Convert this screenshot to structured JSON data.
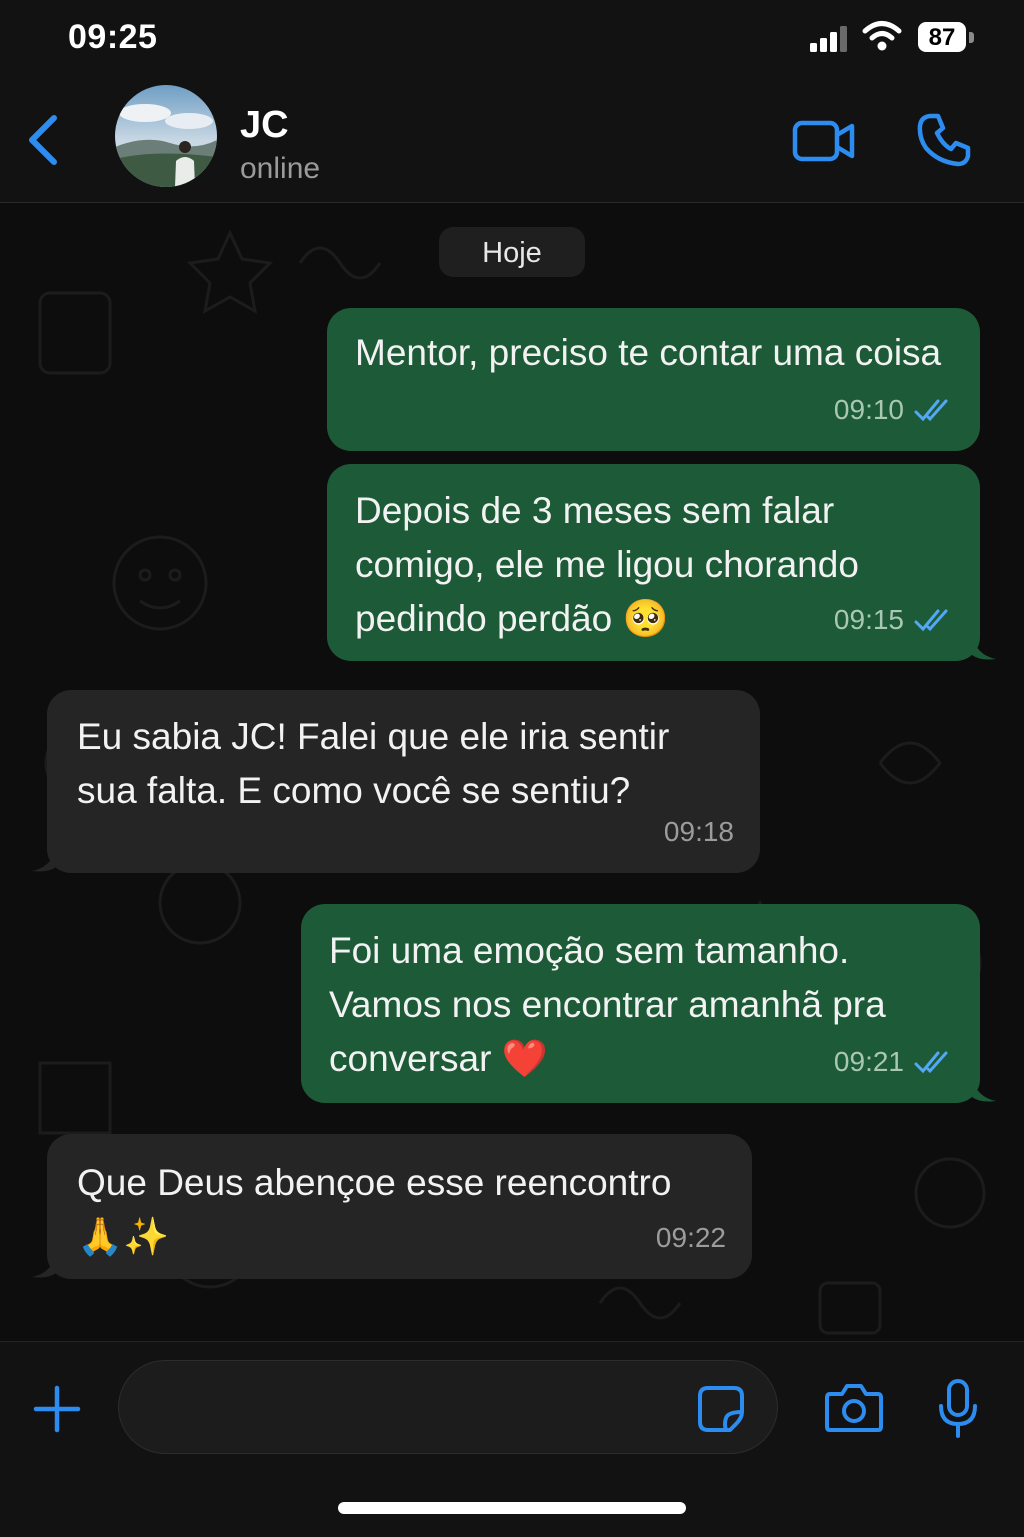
{
  "status_bar": {
    "time": "09:25",
    "battery": "87"
  },
  "header": {
    "contact_name": "JC",
    "contact_status": "online",
    "icons": [
      "back-chevron-icon",
      "video-call-icon",
      "phone-call-icon"
    ]
  },
  "chat": {
    "date_label": "Hoje",
    "messages": [
      {
        "direction": "outgoing",
        "text": "Mentor, preciso te contar uma coisa",
        "time": "09:10",
        "read": true
      },
      {
        "direction": "outgoing",
        "text": "Depois de 3 meses sem falar comigo, ele me ligou chorando pedindo perdão 🥺",
        "time": "09:15",
        "read": true
      },
      {
        "direction": "incoming",
        "text": "Eu sabia JC! Falei que ele iria sentir sua falta. E como você se sentiu?",
        "time": "09:18"
      },
      {
        "direction": "outgoing",
        "text": "Foi uma emoção sem tamanho. Vamos nos encontrar amanhã pra conversar ❤️",
        "time": "09:21",
        "read": true
      },
      {
        "direction": "incoming",
        "text": "Que Deus abençoe esse reencontro 🙏✨",
        "time": "09:22"
      }
    ]
  },
  "input_bar": {
    "message_value": "",
    "icons": [
      "plus-icon",
      "sticker-icon",
      "camera-icon",
      "microphone-icon"
    ]
  },
  "colors": {
    "accent_blue": "#2d8cf0",
    "outgoing_bubble": "#1d5b38",
    "incoming_bubble": "#252525",
    "read_ticks": "#53a7f5"
  }
}
